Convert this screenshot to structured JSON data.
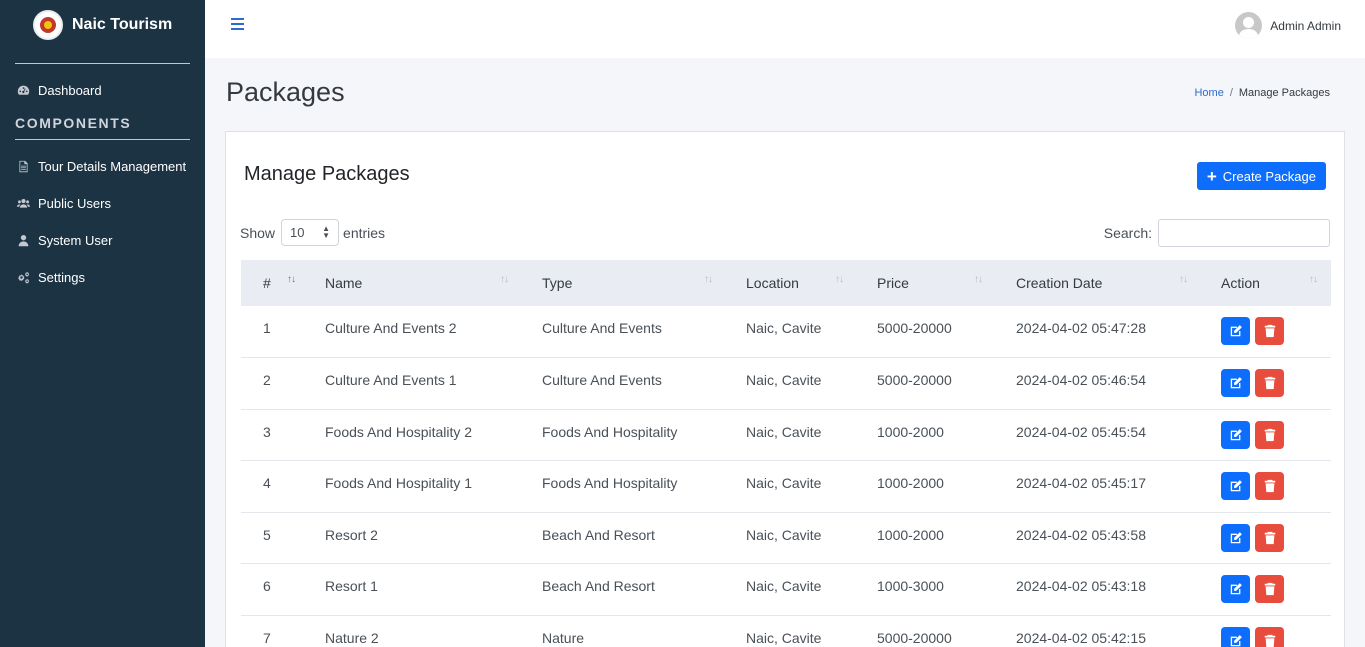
{
  "brand": {
    "name": "Naic Tourism"
  },
  "sidebar": {
    "dashboard": "Dashboard",
    "section_header": "COMPONENTS",
    "items": [
      {
        "label": "Tour Details Management",
        "icon": "file-icon"
      },
      {
        "label": "Public Users",
        "icon": "users-icon"
      },
      {
        "label": "System User",
        "icon": "user-icon"
      },
      {
        "label": "Settings",
        "icon": "gears-icon"
      }
    ]
  },
  "topbar": {
    "user_name": "Admin Admin"
  },
  "page": {
    "title": "Packages",
    "breadcrumb": {
      "home": "Home",
      "separator": "/",
      "current": "Manage Packages"
    }
  },
  "card": {
    "title": "Manage Packages",
    "create_button": "Create Package",
    "show_label": "Show",
    "entries_value": "10",
    "entries_label": "entries",
    "search_label": "Search:",
    "search_value": ""
  },
  "table": {
    "headers": [
      "#",
      "Name",
      "Type",
      "Location",
      "Price",
      "Creation Date",
      "Action"
    ],
    "rows": [
      [
        "1",
        "Culture And Events 2",
        "Culture And Events",
        "Naic, Cavite",
        "5000-20000",
        "2024-04-02 05:47:28"
      ],
      [
        "2",
        "Culture And Events 1",
        "Culture And Events",
        "Naic, Cavite",
        "5000-20000",
        "2024-04-02 05:46:54"
      ],
      [
        "3",
        "Foods And Hospitality 2",
        "Foods And Hospitality",
        "Naic, Cavite",
        "1000-2000",
        "2024-04-02 05:45:54"
      ],
      [
        "4",
        "Foods And Hospitality 1",
        "Foods And Hospitality",
        "Naic, Cavite",
        "1000-2000",
        "2024-04-02 05:45:17"
      ],
      [
        "5",
        "Resort 2",
        "Beach And Resort",
        "Naic, Cavite",
        "1000-2000",
        "2024-04-02 05:43:58"
      ],
      [
        "6",
        "Resort 1",
        "Beach And Resort",
        "Naic, Cavite",
        "1000-3000",
        "2024-04-02 05:43:18"
      ],
      [
        "7",
        "Nature 2",
        "Nature",
        "Naic, Cavite",
        "5000-20000",
        "2024-04-02 05:42:15"
      ]
    ]
  },
  "colors": {
    "sidebar_bg": "#1c3344",
    "primary": "#0d6efd",
    "danger": "#e74c3c",
    "link": "#2e6bcf"
  }
}
